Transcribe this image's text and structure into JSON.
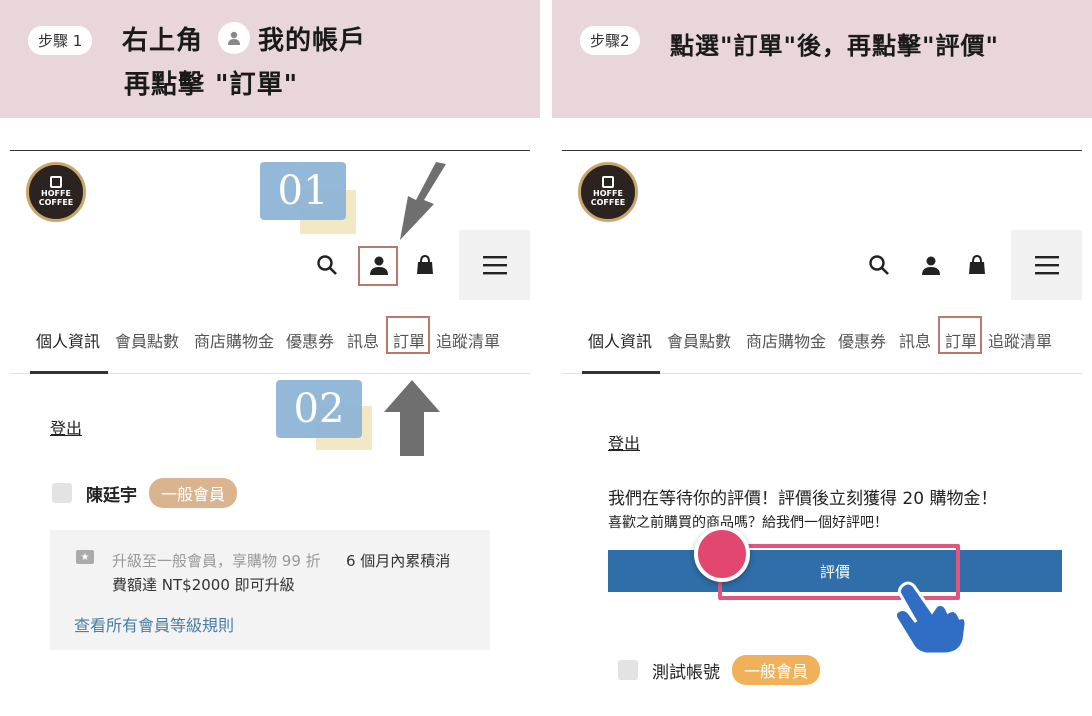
{
  "step1": {
    "pill": "步驟 1",
    "title_line1_a": "右上角",
    "title_line1_b": "我的帳戶",
    "title_line2": "再點擊 \"訂單\""
  },
  "step2": {
    "pill": "步驟2",
    "title": "點選\"訂單\"後，再點擊\"評價\""
  },
  "logo": {
    "line1": "HOFFE",
    "line2": "COFFEE"
  },
  "tabs": [
    "個人資訊",
    "會員點數",
    "商店購物金",
    "優惠券",
    "訊息",
    "訂單",
    "追蹤清單"
  ],
  "callouts": {
    "one": "01",
    "two": "02"
  },
  "left": {
    "logout": "登出",
    "user_name": "陳廷宇",
    "badge": "一般會員",
    "upgrade_muted": "升級至一般會員，享購物 99 折",
    "upgrade_line1_tail": "6 個月內累積消",
    "upgrade_line2": "費額達 NT$2000 即可升級",
    "rules_link": "查看所有會員等級規則"
  },
  "right": {
    "logout": "登出",
    "review_line1": "我們在等待你的評價！評價後立刻獲得 20 購物金！",
    "review_line2": "喜歡之前購買的商品嗎？給我們一個好評吧！",
    "review_button": "評價",
    "user_name": "測試帳號",
    "badge": "一般會員"
  },
  "colors": {
    "banner": "#e8d6da",
    "badge": "#d9b48f",
    "highlight": "#b67a6c",
    "review_button": "#2f6ea8",
    "pink_box": "#e0567c",
    "callout_blue": "#8fb5d6"
  }
}
